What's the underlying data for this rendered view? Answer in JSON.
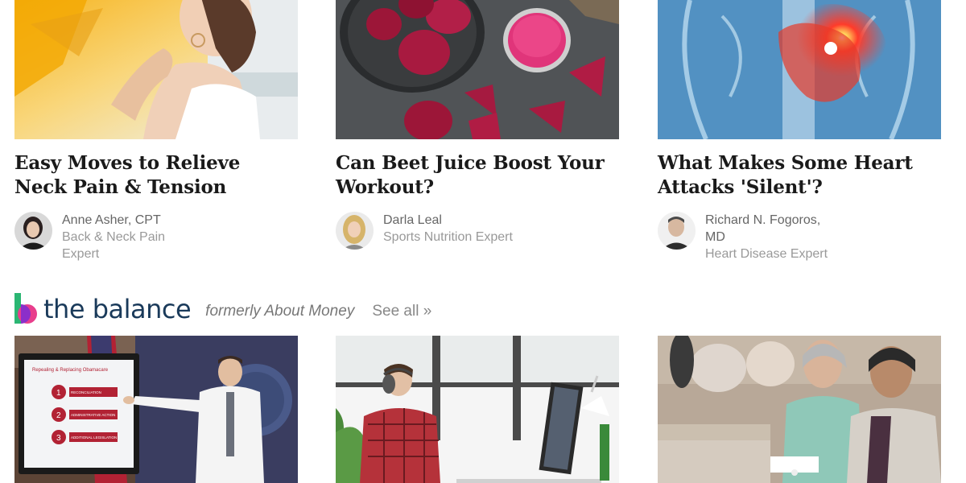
{
  "articles": [
    {
      "title": "Easy Moves to Relieve Neck Pain & Tension",
      "author_name": "Anne Asher, CPT",
      "author_role": "Back & Neck Pain Expert"
    },
    {
      "title": "Can Beet Juice Boost Your Workout?",
      "author_name": "Darla Leal",
      "author_role": "Sports Nutrition Expert"
    },
    {
      "title": "What Makes Some Heart Attacks 'Silent'?",
      "author_name": "Richard N. Fogoros, MD",
      "author_role": "Heart Disease Expert"
    }
  ],
  "brand": {
    "name": "the balance",
    "subtitle": "formerly About Money",
    "see_all": "See all »"
  },
  "presentation_slide": {
    "heading": "Repealing & Replacing Obamacare",
    "steps": [
      "RECONCILIATION",
      "ADMINISTRATIVE ACTION",
      "ADDITIONAL LEGISLATION"
    ],
    "numbers": [
      "1",
      "2",
      "3"
    ]
  },
  "colors": {
    "logo_green": "#2bb673",
    "logo_purple": "#8b2fc9",
    "logo_pink": "#e83e8c",
    "brand_text": "#1a3a5a"
  }
}
